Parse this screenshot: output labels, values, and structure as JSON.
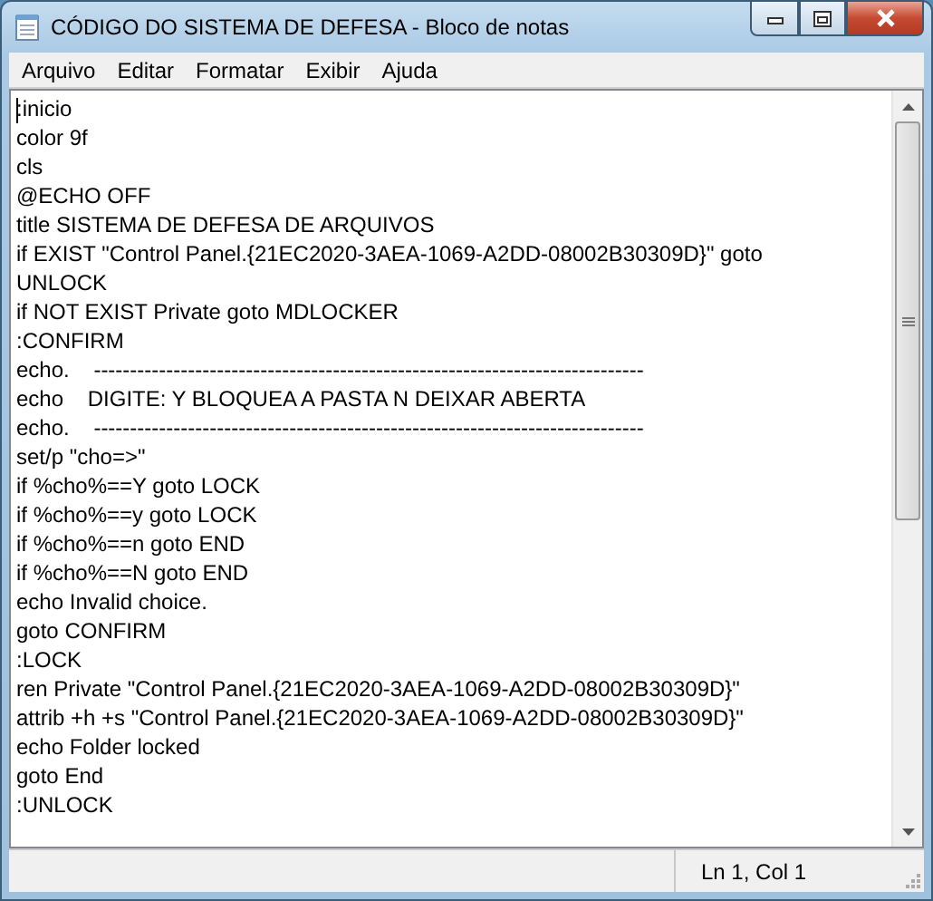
{
  "window": {
    "title": "CÓDIGO DO SISTEMA DE DEFESA - Bloco de notas"
  },
  "menu": [
    "Arquivo",
    "Editar",
    "Formatar",
    "Exibir",
    "Ajuda"
  ],
  "editor": {
    "lines": [
      ":inicio",
      "color 9f",
      "cls",
      "@ECHO OFF",
      "title SISTEMA DE DEFESA DE ARQUIVOS",
      "if EXIST \"Control Panel.{21EC2020-3AEA-1069-A2DD-08002B30309D}\" goto",
      "UNLOCK",
      "if NOT EXIST Private goto MDLOCKER",
      ":CONFIRM",
      "echo.    ----------------------------------------------------------------------------",
      "echo    DIGITE: Y BLOQUEA A PASTA N DEIXAR ABERTA",
      "echo.    ----------------------------------------------------------------------------",
      "set/p \"cho=>\"",
      "if %cho%==Y goto LOCK",
      "if %cho%==y goto LOCK",
      "if %cho%==n goto END",
      "if %cho%==N goto END",
      "echo Invalid choice.",
      "goto CONFIRM",
      ":LOCK",
      "ren Private \"Control Panel.{21EC2020-3AEA-1069-A2DD-08002B30309D}\"",
      "attrib +h +s \"Control Panel.{21EC2020-3AEA-1069-A2DD-08002B30309D}\"",
      "echo Folder locked",
      "goto End",
      ":UNLOCK"
    ]
  },
  "status_bar": {
    "position": "Ln 1, Col 1"
  }
}
